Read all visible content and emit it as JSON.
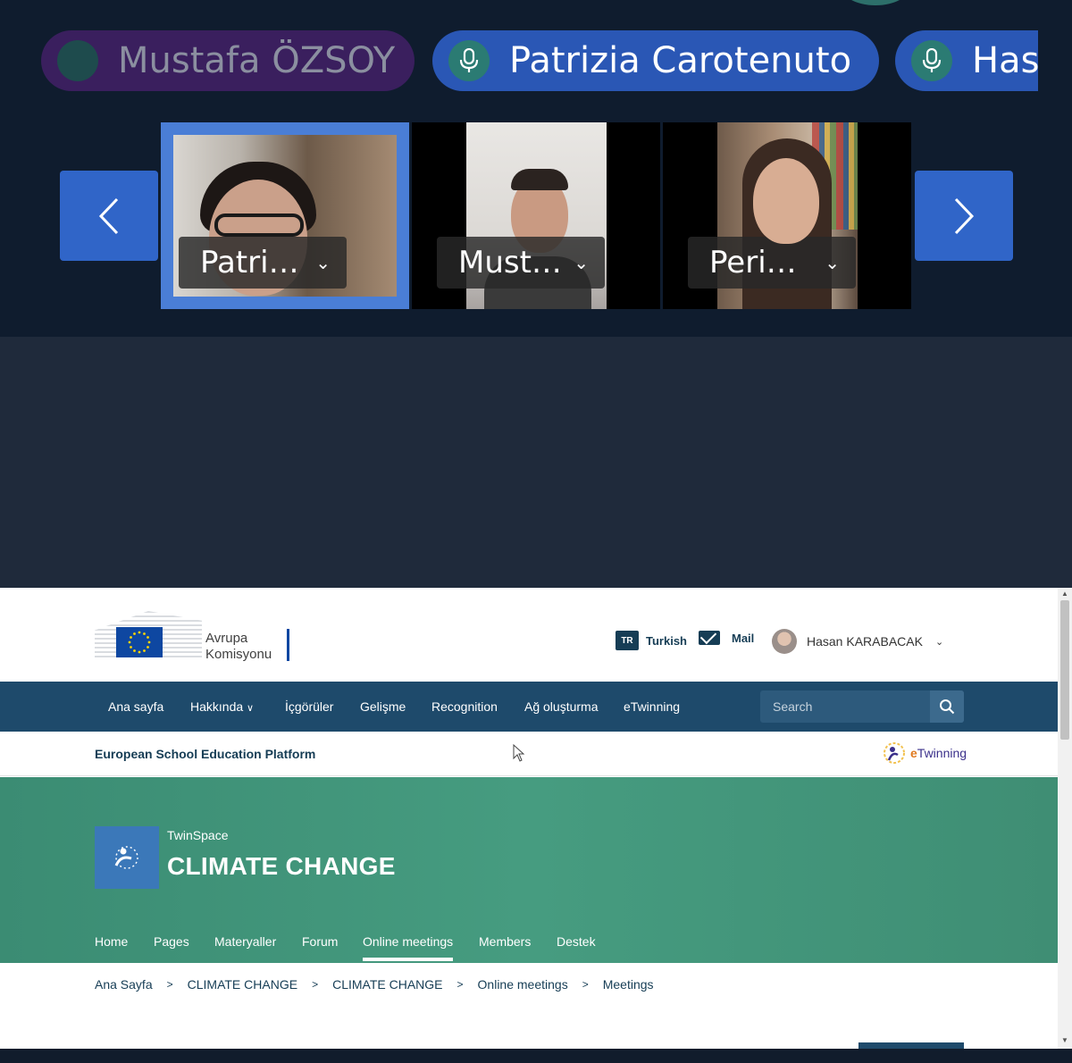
{
  "call": {
    "participants_bar": [
      {
        "name": "Mustafa ÖZSOY"
      },
      {
        "name": "Patrizia Carotenuto"
      },
      {
        "name": "Has"
      }
    ],
    "tiles": [
      {
        "label": "Patri…"
      },
      {
        "label": "Must…"
      },
      {
        "label": "Peri…"
      }
    ],
    "prev_icon": "chevron-left-icon",
    "next_icon": "chevron-right-icon"
  },
  "header": {
    "logo_line1": "Avrupa",
    "logo_line2": "Komisyonu",
    "lang_code": "TR",
    "lang_label": "Turkish",
    "mail_label": "Mail",
    "user_name": "Hasan KARABACAK"
  },
  "nav": {
    "items": [
      "Ana sayfa",
      "Hakkında",
      "İçgörüler",
      "Gelişme",
      "Recognition",
      "Ağ oluşturma",
      "eTwinning"
    ],
    "search_placeholder": "Search"
  },
  "platform": {
    "title": "European School Education Platform",
    "etwinning_e": "e",
    "etwinning_rest": "Twinning"
  },
  "twinspace": {
    "subtitle": "TwinSpace",
    "title": "CLIMATE CHANGE",
    "tabs": [
      "Home",
      "Pages",
      "Materyaller",
      "Forum",
      "Online meetings",
      "Members",
      "Destek"
    ],
    "active_tab": "Online meetings"
  },
  "breadcrumb": [
    "Ana Sayfa",
    "CLIMATE CHANGE",
    "CLIMATE CHANGE",
    "Online meetings",
    "Meetings"
  ],
  "colors": {
    "call_bg": "#0f1c2e",
    "pill_active": "#2a57b5",
    "nav_bg": "#1e4a6b",
    "hero_green": "#469c80",
    "nav_button": "#3065c8"
  }
}
